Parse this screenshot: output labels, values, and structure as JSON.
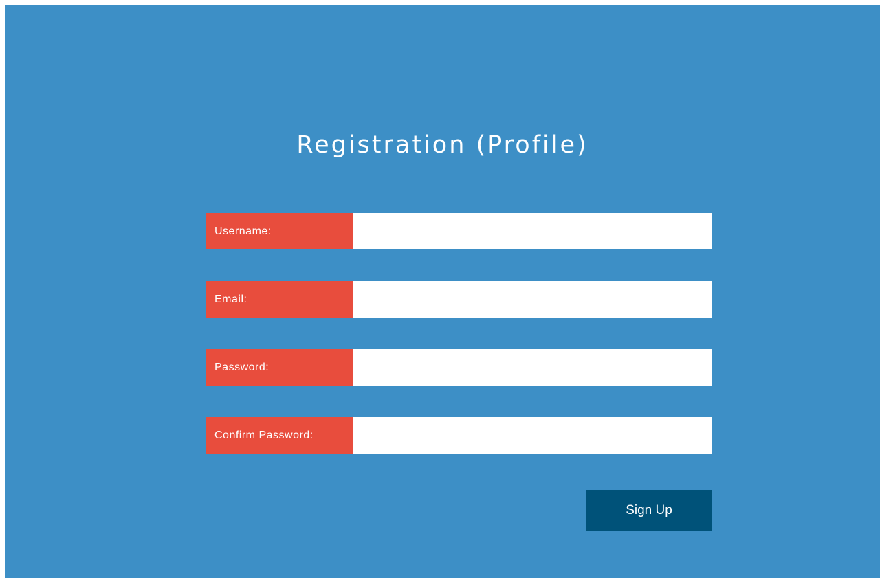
{
  "page": {
    "title": "Registration (Profile)"
  },
  "form": {
    "fields": [
      {
        "label": "Username:",
        "value": "",
        "type": "text"
      },
      {
        "label": "Email:",
        "value": "",
        "type": "email"
      },
      {
        "label": "Password:",
        "value": "",
        "type": "password"
      },
      {
        "label": "Confirm Password:",
        "value": "",
        "type": "password"
      }
    ],
    "submit_label": "Sign Up"
  },
  "colors": {
    "background": "#3d8fc6",
    "label_bg": "#e84d3d",
    "button_bg": "#005279",
    "text": "#ffffff"
  }
}
